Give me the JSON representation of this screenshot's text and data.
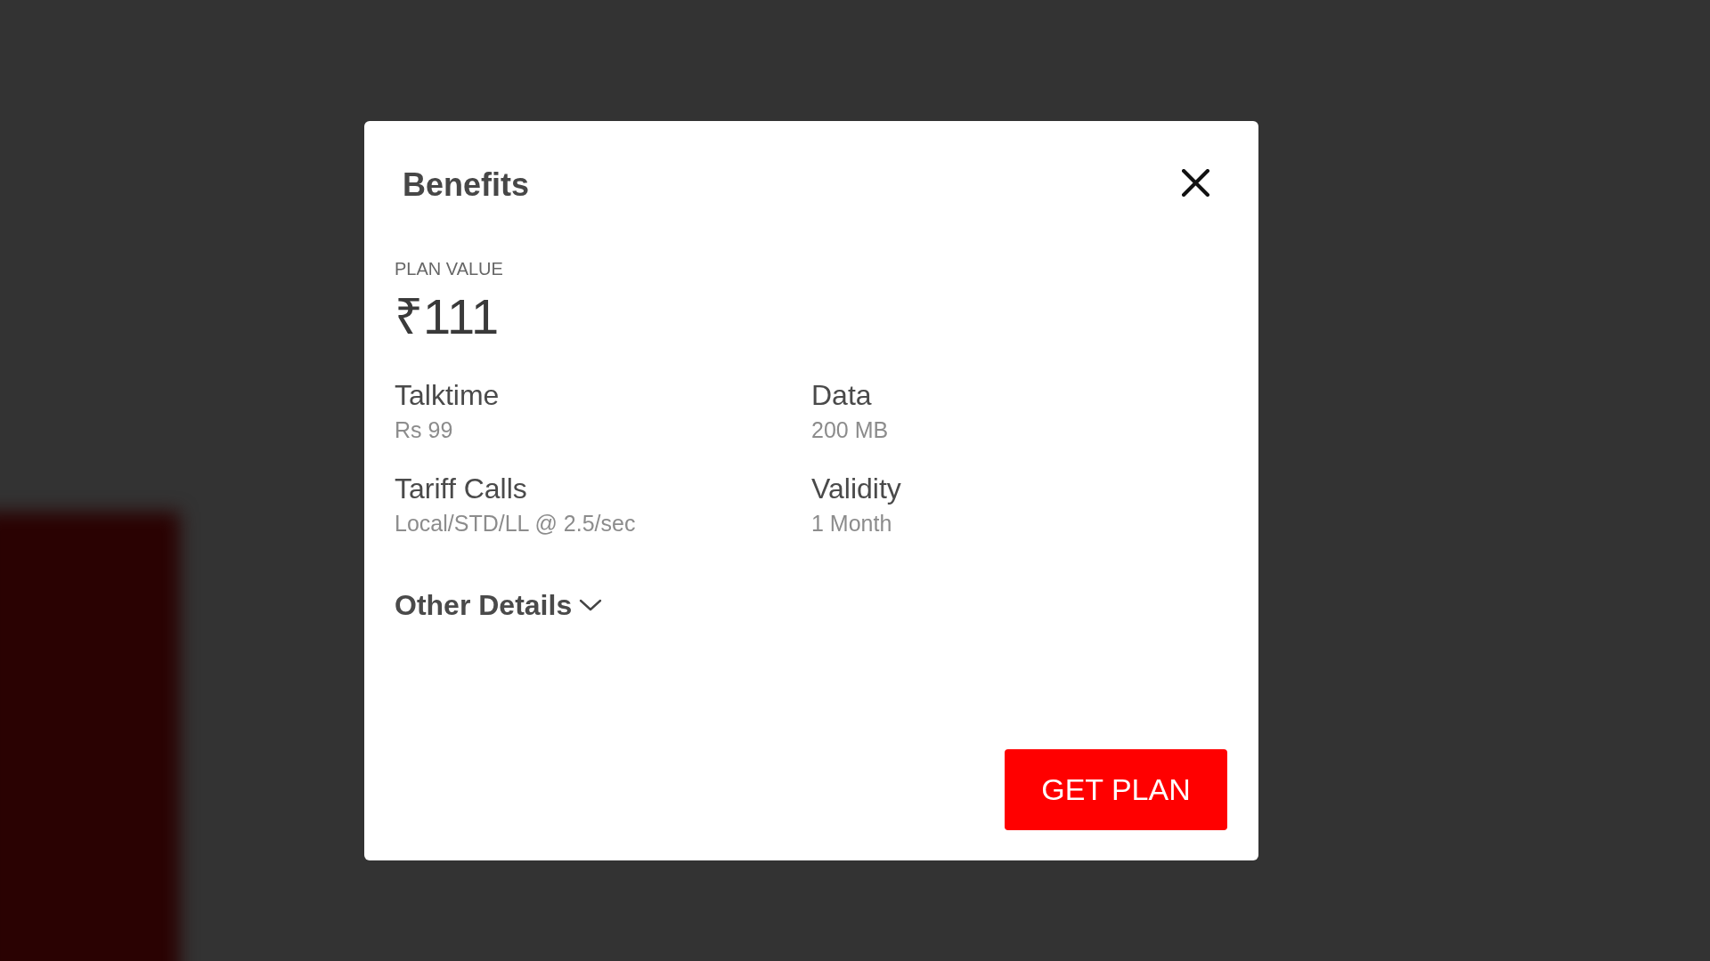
{
  "dialog": {
    "title": "Benefits",
    "plan_value": {
      "label": "PLAN VALUE",
      "amount": "₹111"
    },
    "benefits": [
      {
        "label": "Talktime",
        "value": "Rs 99"
      },
      {
        "label": "Data",
        "value": "200 MB"
      },
      {
        "label": "Tariff Calls",
        "value": "Local/STD/LL @ 2.5/sec"
      },
      {
        "label": "Validity",
        "value": "1 Month"
      }
    ],
    "other_details": {
      "label": "Other Details",
      "expanded": false
    },
    "button": "GET PLAN"
  }
}
